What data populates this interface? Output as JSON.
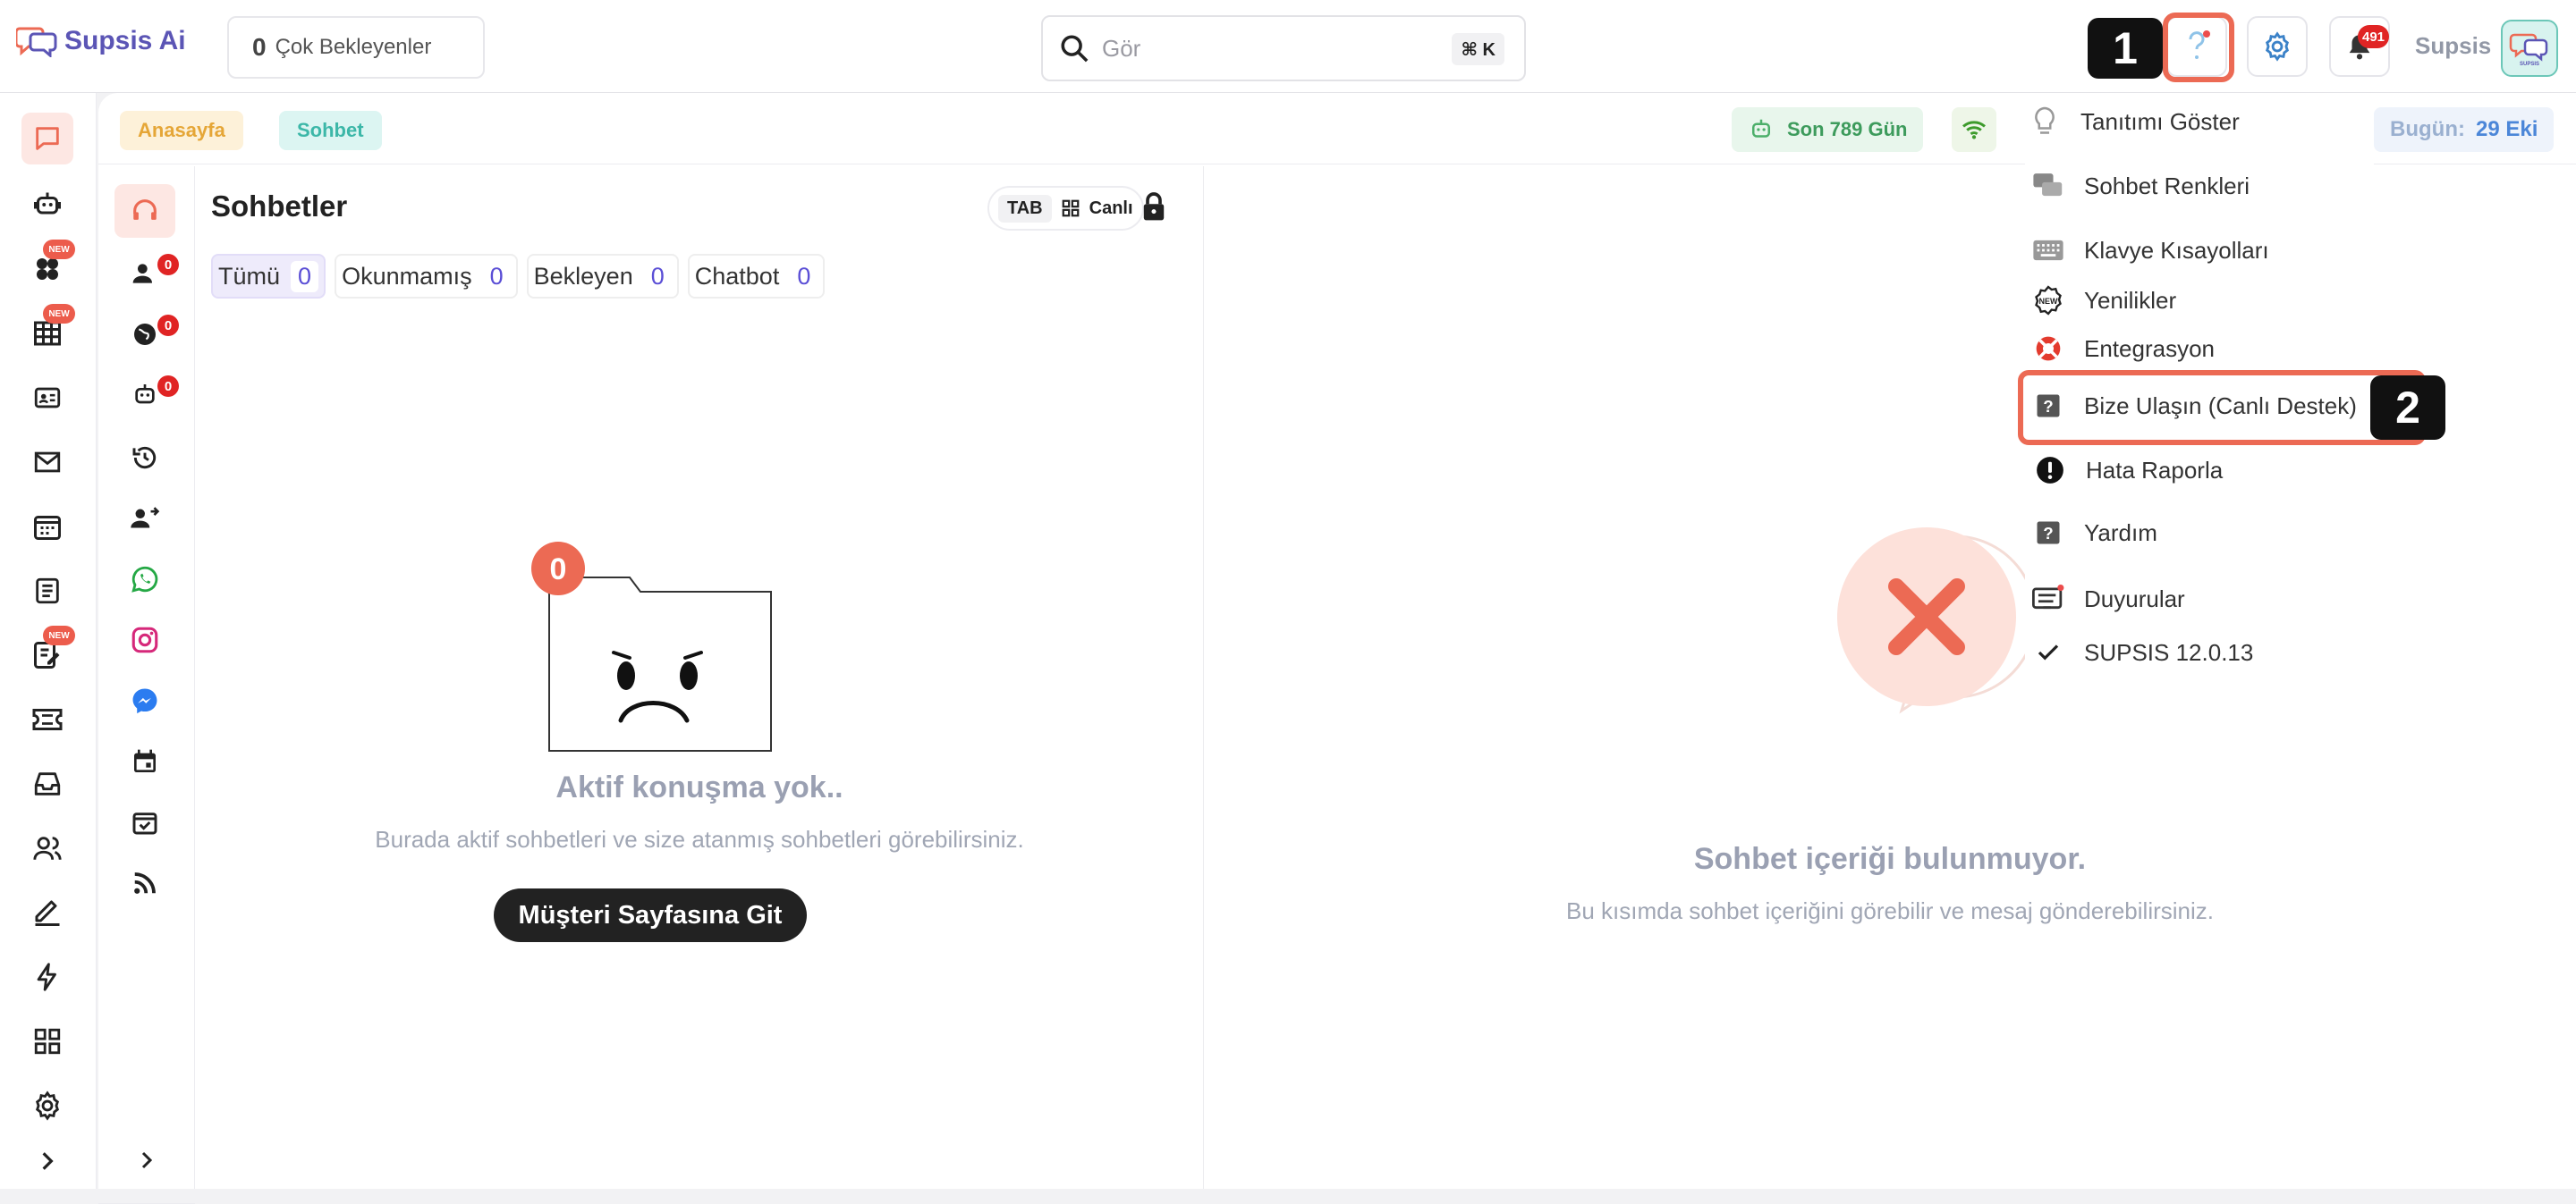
{
  "app": {
    "name": "Supsis Ai"
  },
  "header": {
    "pending_count": "0",
    "pending_label": "Çok Bekleyenler",
    "search_placeholder": "Gör",
    "search_shortcut": "⌘ K",
    "notification_count": "491",
    "user_name": "Supsis",
    "avatar_text": "SUPSIS"
  },
  "annotations": {
    "marker1": "1",
    "marker2": "2"
  },
  "breadcrumbs": {
    "home": "Anasayfa",
    "current": "Sohbet"
  },
  "status": {
    "days_label": "Son 789 Gün",
    "today_label": "Bugün:",
    "today_value": "29 Eki"
  },
  "rail": {
    "new_badge": "NEW"
  },
  "subrail": {
    "counts": [
      "0",
      "0",
      "0"
    ]
  },
  "chats": {
    "title": "Sohbetler",
    "tab_label": "TAB",
    "live_label": "Canlı",
    "filters": [
      {
        "label": "Tümü",
        "count": "0"
      },
      {
        "label": "Okunmamış",
        "count": "0"
      },
      {
        "label": "Bekleyen",
        "count": "0"
      },
      {
        "label": "Chatbot",
        "count": "0"
      }
    ],
    "folder_badge": "0",
    "empty_title": "Aktif konuşma yok..",
    "empty_subtitle": "Burada aktif sohbetleri ve size atanmış sohbetleri görebilirsiniz.",
    "customer_button": "Müşteri Sayfasına Git"
  },
  "detail": {
    "empty_title": "Sohbet içeriği bulunmuyor.",
    "empty_subtitle": "Bu kısımda sohbet içeriğini görebilir ve mesaj gönderebilirsiniz."
  },
  "help_menu": {
    "items": [
      {
        "label": "Tanıtımı Göster",
        "icon": "lightbulb-icon"
      },
      {
        "label": "Sohbet Renkleri",
        "icon": "chat-bubbles-icon"
      },
      {
        "label": "Klavye Kısayolları",
        "icon": "keyboard-icon"
      },
      {
        "label": "Yenilikler",
        "icon": "new-seal-icon"
      },
      {
        "label": "Entegrasyon",
        "icon": "lifebuoy-icon"
      },
      {
        "label": "Bize Ulaşın (Canlı Destek)",
        "icon": "question-square-icon"
      },
      {
        "label": "Hata Raporla",
        "icon": "alert-icon"
      },
      {
        "label": "Yardım",
        "icon": "question-square-icon"
      },
      {
        "label": "Duyurular",
        "icon": "announcement-icon"
      },
      {
        "label": "SUPSIS 12.0.13",
        "icon": "check-icon"
      }
    ]
  },
  "colors": {
    "brand": "#5b55b5",
    "accent": "#ec6a54",
    "chat_accent": "#3cb7a8"
  }
}
